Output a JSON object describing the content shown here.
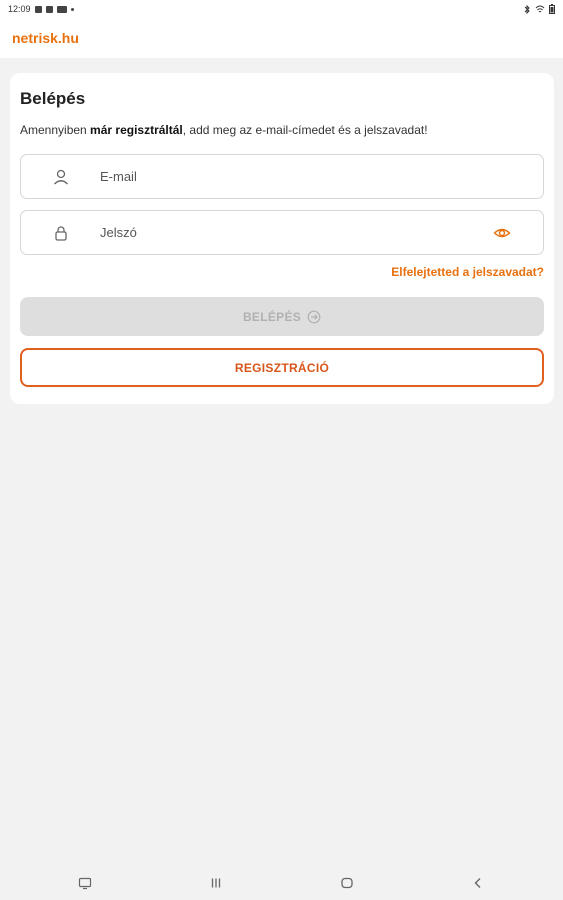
{
  "status_bar": {
    "time": "12:09",
    "icons": [
      "calendar-icon",
      "gallery-icon",
      "video-icon",
      "dot-icon"
    ],
    "right_icons": [
      "bluetooth-icon",
      "wifi-icon",
      "battery-icon"
    ]
  },
  "app": {
    "brand": "netrisk.hu",
    "accent_color": "#e8710f"
  },
  "login": {
    "title": "Belépés",
    "subtitle_pre": "Amennyiben ",
    "subtitle_bold": "már regisztráltál",
    "subtitle_post": ", add meg az e-mail-címedet és a jelszavadat!",
    "email_label": "E-mail",
    "password_label": "Jelszó",
    "forgot_link": "Elfelejtetted a jelszavadat?",
    "login_button": "BELÉPÉS",
    "register_button": "REGISZTRÁCIÓ"
  },
  "navbar": {
    "items": [
      "recents-apps-icon",
      "home-icon",
      "back-icon",
      "keyboard-icon"
    ]
  }
}
